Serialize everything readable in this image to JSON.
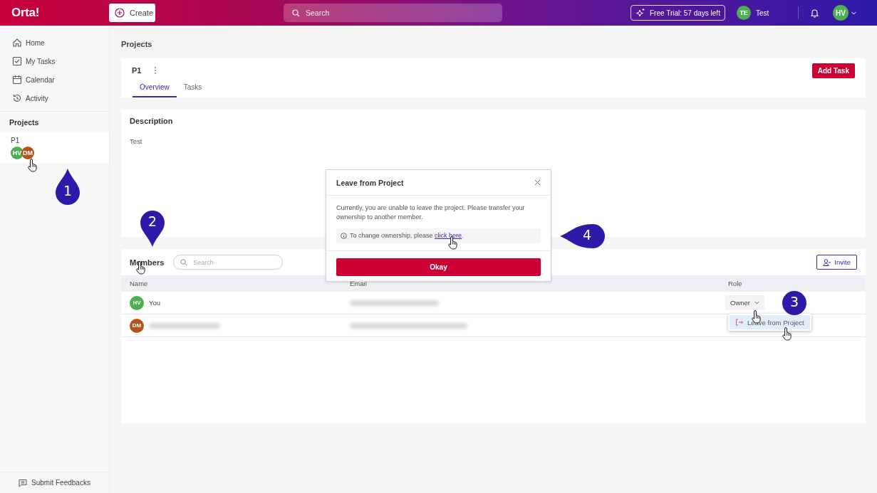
{
  "topbar": {
    "logo": "Orta!",
    "create_button": "Create",
    "search": {
      "placeholder": "Search"
    },
    "trial_badge": "Free Trial: 57 days left",
    "workspace": {
      "initials": "TE",
      "name": "Test",
      "color": "#4caf50"
    },
    "user_avatar": {
      "initials": "HV",
      "color": "#4caf50"
    }
  },
  "sidebar": {
    "nav": [
      {
        "label": "Home"
      },
      {
        "label": "My Tasks"
      },
      {
        "label": "Calendar"
      },
      {
        "label": "Activity"
      }
    ],
    "projects_heading": "Projects",
    "projects": [
      {
        "name": "P1",
        "members": [
          {
            "initials": "HV",
            "color": "#4caf50"
          },
          {
            "initials": "DM",
            "color": "#b5541a"
          }
        ]
      }
    ],
    "feedback_button": "Submit Feedbacks"
  },
  "page_title": "Projects",
  "project": {
    "name": "P1",
    "add_task_button": "Add Task",
    "tabs": [
      {
        "label": "Overview",
        "selected": true
      },
      {
        "label": "Tasks",
        "selected": false
      }
    ]
  },
  "description": {
    "heading": "Description",
    "text": "Test"
  },
  "members": {
    "heading": "Members",
    "search": {
      "placeholder": "Search"
    },
    "invite_button": "Invite",
    "columns": [
      "Name",
      "Email",
      "Role"
    ],
    "rows": [
      {
        "initials": "HV",
        "color": "#4caf50",
        "name": "You",
        "role": "Owner",
        "menu": [
          "Leave from Project"
        ]
      },
      {
        "initials": "DM",
        "color": "#b5541a"
      }
    ]
  },
  "dialog": {
    "title": "Leave from Project",
    "message": "Currently, you are unable to leave the project. Please transfer your ownership to another member.",
    "note": "To change ownership, please ",
    "link": "click here",
    "note_end": ".",
    "button": "Okay"
  },
  "callouts": [
    {
      "label": "1",
      "kind": "up"
    },
    {
      "label": "2",
      "kind": "down"
    },
    {
      "label": "3",
      "kind": "round"
    },
    {
      "label": "4",
      "kind": "left"
    }
  ]
}
